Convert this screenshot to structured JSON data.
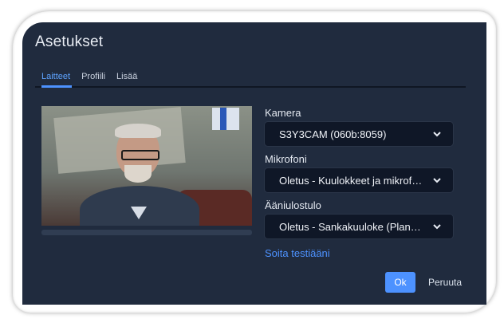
{
  "dialog": {
    "title": "Asetukset"
  },
  "tabs": [
    {
      "label": "Laitteet",
      "active": true
    },
    {
      "label": "Profiili",
      "active": false
    },
    {
      "label": "Lisää",
      "active": false
    }
  ],
  "camera": {
    "label": "Kamera",
    "value": "S3Y3CAM (060b:8059)"
  },
  "microphone": {
    "label": "Mikrofoni",
    "value": "Oletus - Kuulokkeet ja mikrofoni"
  },
  "audio_output": {
    "label": "Ääniulostulo",
    "value": "Oletus - Sankakuuloke (Plantronics)"
  },
  "mic_level": 0,
  "test_sound_link": "Soita testiääni",
  "buttons": {
    "ok": "Ok",
    "cancel": "Peruuta"
  },
  "colors": {
    "background": "#202b3e",
    "accent": "#4d92ff",
    "select_bg": "#0f1727"
  },
  "icons": {
    "dropdown": "chevron-down-icon"
  }
}
